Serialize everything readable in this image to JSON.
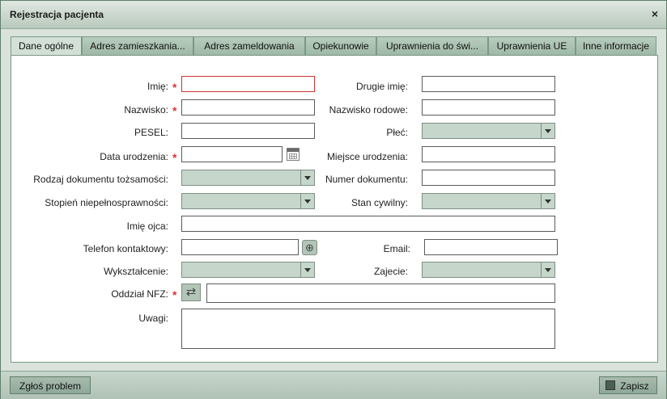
{
  "window": {
    "title": "Rejestracja pacjenta",
    "close_glyph": "×"
  },
  "tabs": [
    {
      "label": "Dane ogólne"
    },
    {
      "label": "Adres zamieszkania..."
    },
    {
      "label": "Adres zameldowania"
    },
    {
      "label": "Opiekunowie"
    },
    {
      "label": "Uprawnienia do świ..."
    },
    {
      "label": "Uprawnienia UE"
    },
    {
      "label": "Inne informacje"
    }
  ],
  "form": {
    "imie": "Imię:",
    "drugie_imie": "Drugie imię:",
    "nazwisko": "Nazwisko:",
    "nazwisko_rodowe": "Nazwisko rodowe:",
    "pesel": "PESEL:",
    "plec": "Płeć:",
    "data_urodzenia": "Data urodzenia:",
    "miejsce_urodzenia": "Miejsce urodzenia:",
    "rodzaj_dokumentu": "Rodzaj dokumentu tożsamości:",
    "numer_dokumentu": "Numer dokumentu:",
    "stopien_niepelnosprawnosci": "Stopień niepełnosprawności:",
    "stan_cywilny": "Stan cywilny:",
    "imie_ojca": "Imię ojca:",
    "telefon": "Telefon kontaktowy:",
    "email": "Email:",
    "wyksztalcenie": "Wykształcenie:",
    "zajecie": "Zajecie:",
    "oddzial_nfz": "Oddział NFZ:",
    "uwagi": "Uwagi:",
    "required_mark": "*"
  },
  "footer": {
    "report": "Zgłoś problem",
    "save": "Zapisz"
  },
  "colors": {
    "accent": "#7c9a86",
    "required": "#d33333"
  }
}
